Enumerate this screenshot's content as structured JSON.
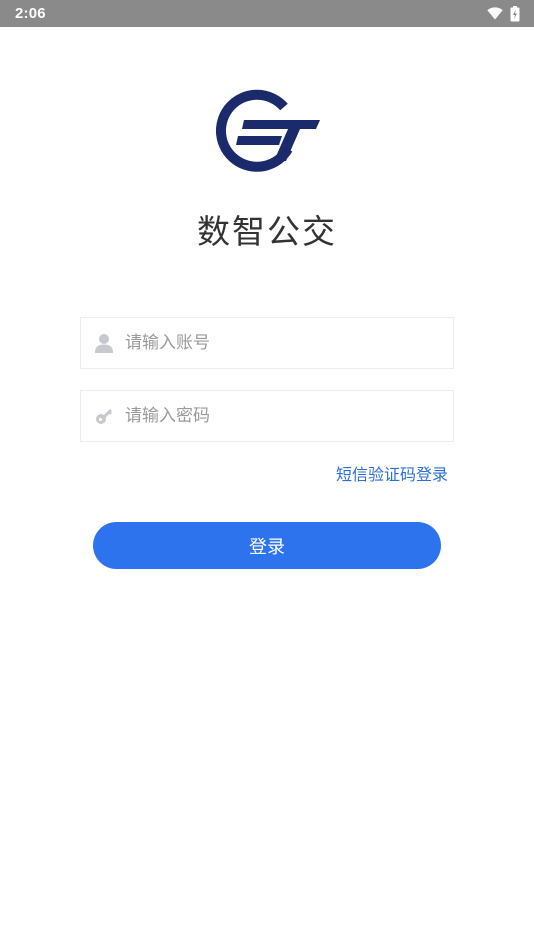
{
  "status_bar": {
    "time": "2:06",
    "icons": [
      "wifi-icon",
      "battery-charging-icon"
    ]
  },
  "app": {
    "title": "数智公交",
    "logo_color": "#1b2a6b"
  },
  "login_form": {
    "account_placeholder": "请输入账号",
    "account_icon": "user-icon",
    "password_placeholder": "请输入密码",
    "password_icon": "key-icon",
    "sms_login_link": "短信验证码登录",
    "submit_label": "登录"
  },
  "colors": {
    "accent": "#2e73ee",
    "link": "#2d6fd8",
    "status_bar": "#8a8a8a"
  }
}
